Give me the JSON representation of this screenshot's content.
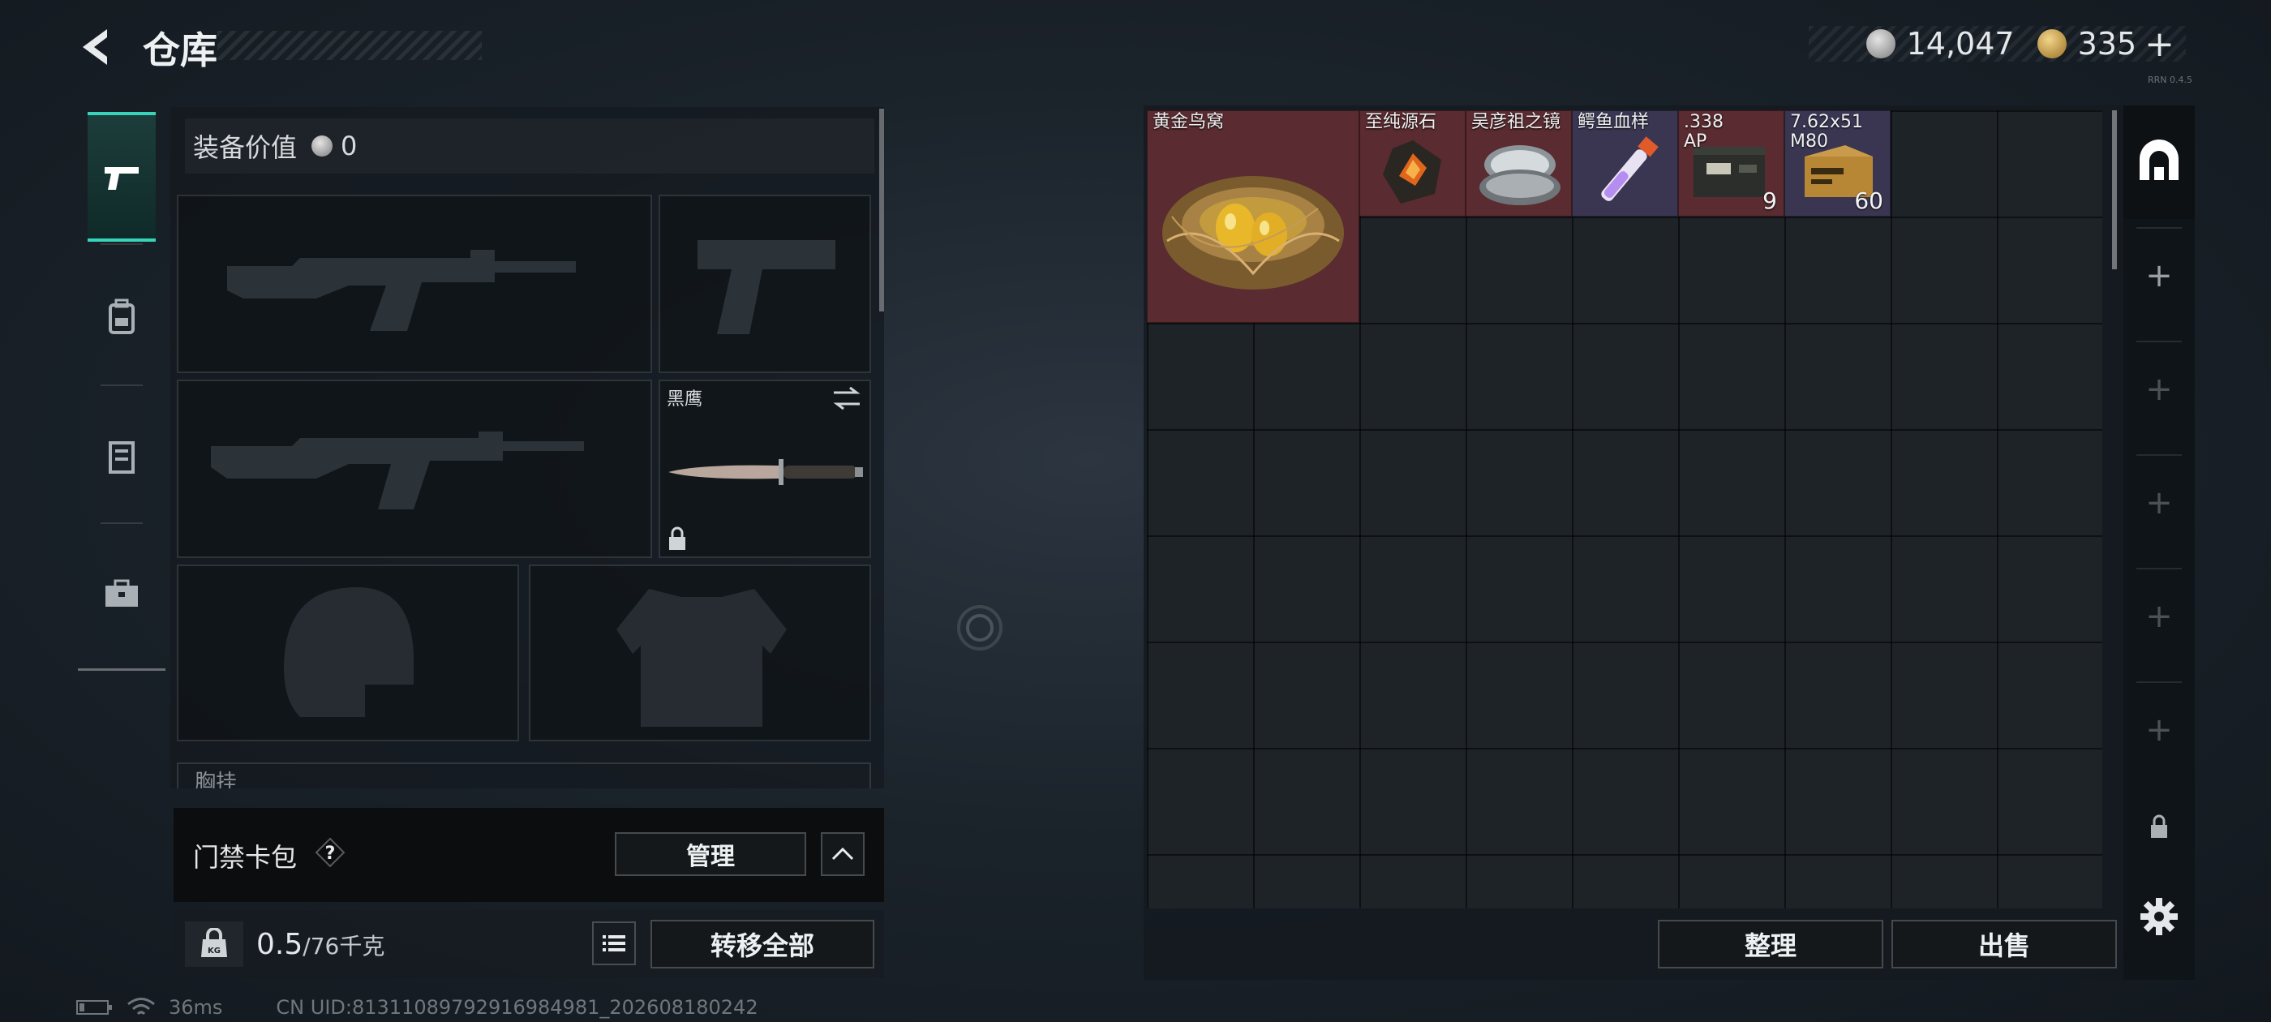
{
  "header": {
    "title": "仓库",
    "currency_silver": "14,047",
    "currency_gold": "335",
    "plus_label": "+",
    "build": "RRN 0.4.5"
  },
  "left_panel": {
    "equip_value_label": "装备价值",
    "equip_value": "0",
    "melee_label": "黑鹰",
    "chest_label": "胸挂",
    "keycard_label": "门禁卡包",
    "manage_label": "管理",
    "weight_current": "0.5",
    "weight_max": "/76千克",
    "weight_icon_text": "KG",
    "transfer_all_label": "转移全部"
  },
  "status_bar": {
    "ping": "36ms",
    "uid": "CN UID:81311089792916984981_202608180242"
  },
  "stash": {
    "items": [
      {
        "name": "黄金鸟窝",
        "count": "",
        "rarity": "red"
      },
      {
        "name": "至纯源石",
        "count": "",
        "rarity": "red"
      },
      {
        "name": "吴彦祖之镜",
        "count": "",
        "rarity": "red"
      },
      {
        "name": "鳄鱼血样",
        "count": "",
        "rarity": "purple"
      },
      {
        "name": ".338\nAP",
        "count": "9",
        "rarity": "red"
      },
      {
        "name": "7.62x51\nM80",
        "count": "60",
        "rarity": "purple"
      }
    ],
    "sort_label": "整理",
    "sell_label": "出售"
  },
  "colors": {
    "accent": "#38d3b9",
    "red_rarity": "#5a2b30",
    "purple_rarity": "#3a3652"
  },
  "icons": [
    "back-arrow-icon",
    "silver-coin-icon",
    "gold-coin-icon",
    "pistol-icon",
    "backpack-icon",
    "vest-icon",
    "briefcase-icon",
    "swap-icon",
    "lock-icon",
    "help-icon",
    "chevron-up-icon",
    "weight-icon",
    "list-icon",
    "stash-home-icon",
    "plus-icon",
    "settings-icon",
    "battery-icon",
    "wifi-icon"
  ]
}
